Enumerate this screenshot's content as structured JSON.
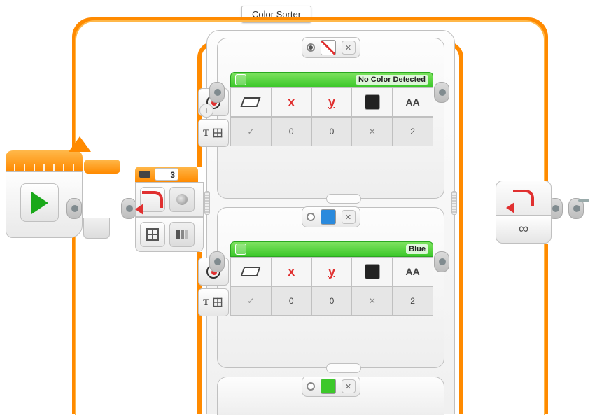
{
  "title": "Color Sorter",
  "start": {
    "label": "Start"
  },
  "switch": {
    "port": "3",
    "mode": "color-sensor"
  },
  "loop_end": {
    "mode": "infinity",
    "symbol": "∞"
  },
  "cases": [
    {
      "color_name": "none",
      "is_default": true,
      "display": {
        "title": "No Color Detected",
        "mode": "text-grid",
        "inputs": {
          "erase": "",
          "x_label": "x",
          "y_label": "y",
          "color": "black",
          "font": "AA"
        },
        "values": {
          "erase": "✓",
          "x": "0",
          "y": "0",
          "color": "✕",
          "font": "2"
        }
      }
    },
    {
      "color_name": "blue",
      "is_default": false,
      "display": {
        "title": "Blue",
        "mode": "text-grid",
        "inputs": {
          "erase": "",
          "x_label": "x",
          "y_label": "y",
          "color": "black",
          "font": "AA"
        },
        "values": {
          "erase": "✓",
          "x": "0",
          "y": "0",
          "color": "✕",
          "font": "2"
        }
      }
    },
    {
      "color_name": "green",
      "is_default": false,
      "display": {
        "title": ""
      }
    }
  ]
}
